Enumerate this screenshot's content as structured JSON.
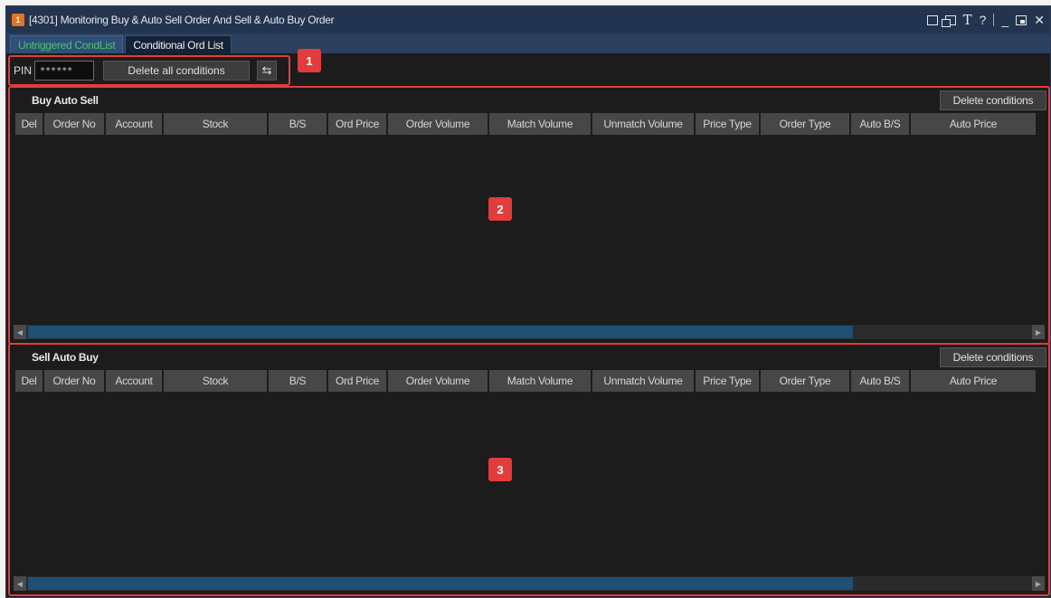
{
  "window": {
    "icon_text": "1",
    "title": "[4301] Monitoring Buy & Auto Sell Order And Sell & Auto Buy Order",
    "controls": {
      "help": "?",
      "font": "T",
      "minimize": "_",
      "close": "✕"
    }
  },
  "tabs": [
    {
      "label": "Untriggered CondList",
      "active": true
    },
    {
      "label": "Conditional Ord List",
      "active": false
    }
  ],
  "toolbar": {
    "pin_label": "PIN",
    "pin_value": "******",
    "delete_all_label": "Delete all conditions",
    "refresh_icon": "⇆"
  },
  "markers": [
    "1",
    "2",
    "3"
  ],
  "columns": [
    "Del",
    "Order No",
    "Account",
    "Stock",
    "B/S",
    "Ord Price",
    "Order Volume",
    "Match Volume",
    "Unmatch Volume",
    "Price Type",
    "Order Type",
    "Auto B/S",
    "Auto Price"
  ],
  "panels": {
    "buy_auto_sell": {
      "title": "Buy Auto Sell",
      "delete_label": "Delete conditions"
    },
    "sell_auto_buy": {
      "title": "Sell Auto Buy",
      "delete_label": "Delete conditions"
    }
  },
  "scroll": {
    "left_arrow": "◀",
    "right_arrow": "▶"
  },
  "colors": {
    "title_bar": "#22344f",
    "active_tab_text": "#4cc36c",
    "highlight": "#e33c3c",
    "scroll_thumb": "#1f4f72",
    "app_icon": "#e8731e"
  }
}
